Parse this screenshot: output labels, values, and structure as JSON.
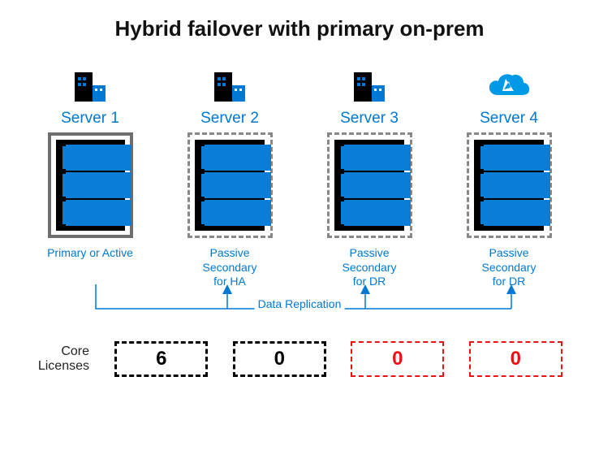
{
  "title": "Hybrid failover with primary on-prem",
  "servers": [
    {
      "name": "Server 1",
      "icon": "building",
      "box_style": "solid",
      "role": "Primary or Active",
      "license_value": "6",
      "license_color": "black"
    },
    {
      "name": "Server 2",
      "icon": "building",
      "box_style": "dashed",
      "role": "Passive\nSecondary\nfor HA",
      "license_value": "0",
      "license_color": "black"
    },
    {
      "name": "Server 3",
      "icon": "building",
      "box_style": "dashed",
      "role": "Passive\nSecondary\nfor DR",
      "license_value": "0",
      "license_color": "red"
    },
    {
      "name": "Server 4",
      "icon": "cloud",
      "box_style": "dashed",
      "role": "Passive\nSecondary\nfor DR",
      "license_value": "0",
      "license_color": "red"
    }
  ],
  "replication_label": "Data Replication",
  "licenses_label": "Core\nLicenses",
  "colors": {
    "azure_blue": "#0078D4",
    "chip_blue": "#0a7ed6"
  }
}
